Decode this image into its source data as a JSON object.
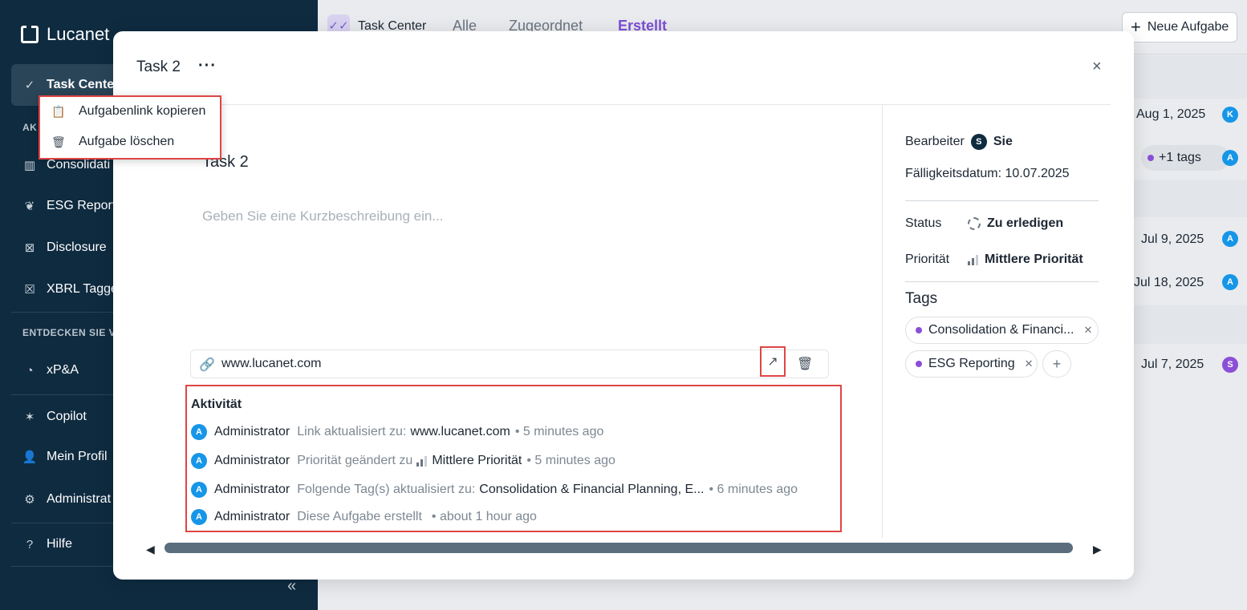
{
  "sidebar": {
    "brand": "Lucanet",
    "items": [
      {
        "label": "Task Center"
      },
      {
        "label": "Consolidati"
      },
      {
        "label": "ESG Report"
      },
      {
        "label": "Disclosure"
      },
      {
        "label": "XBRL Tagge"
      },
      {
        "label": "xP&A"
      },
      {
        "label": "Copilot"
      },
      {
        "label": "Mein Profil"
      },
      {
        "label": "Administrat"
      },
      {
        "label": "Hilfe"
      }
    ],
    "section_apps": "AK",
    "section_discover": "ENTDECKEN SIE V",
    "collapse": "«"
  },
  "header": {
    "task_center": "Task Center",
    "tabs": [
      {
        "label": "Alle"
      },
      {
        "label": "Zugeordnet"
      },
      {
        "label": "Erstellt"
      }
    ],
    "new_task": "Neue Aufgabe"
  },
  "background_rows": {
    "dates": [
      "Aug 1, 2025",
      "Jul 9, 2025",
      "Jul 18, 2025",
      "Jul 7, 2025"
    ],
    "avatars": [
      "K",
      "A",
      "A",
      "A",
      "S"
    ],
    "tags_more": "+1 tags"
  },
  "modal": {
    "title": "Task 2",
    "more": "···",
    "close": "×",
    "task_name": "Task 2",
    "description_placeholder": "Geben Sie eine Kurzbeschreibung ein...",
    "link": "www.lucanet.com",
    "activity_title": "Aktivität",
    "activities": [
      {
        "avatar": "A",
        "user": "Administrator",
        "desc": "Link aktualisiert zu:",
        "value": "www.lucanet.com",
        "time": "• 5 minutes ago"
      },
      {
        "avatar": "A",
        "user": "Administrator",
        "desc": "Priorität geändert zu",
        "value": "Mittlere Priorität",
        "time": "• 5 minutes ago"
      },
      {
        "avatar": "A",
        "user": "Administrator",
        "desc": "Folgende Tag(s) aktualisiert zu:",
        "value": "Consolidation & Financial Planning, E...",
        "time": "• 6 minutes ago"
      },
      {
        "avatar": "A",
        "user": "Administrator",
        "desc": "Diese Aufgabe erstellt",
        "value": "",
        "time": "• about 1 hour ago"
      }
    ],
    "details": {
      "assignee_label": "Bearbeiter",
      "assignee_avatar": "S",
      "assignee_value": "Sie",
      "due_date": "Fälligkeitsdatum: 10.07.2025",
      "status_label": "Status",
      "status_value": "Zu erledigen",
      "priority_label": "Priorität",
      "priority_value": "Mittlere Priorität",
      "tags_label": "Tags",
      "tags": [
        {
          "label": "Consolidation & Financi..."
        },
        {
          "label": "ESG Reporting"
        }
      ],
      "add_tag": "+"
    }
  },
  "context_menu": {
    "items": [
      {
        "label": "Aufgabenlink kopieren"
      },
      {
        "label": "Aufgabe löschen"
      }
    ]
  },
  "colors": {
    "sidebar_bg": "#0f2b40",
    "accent": "#7c4fd6",
    "highlight": "#e04545"
  }
}
